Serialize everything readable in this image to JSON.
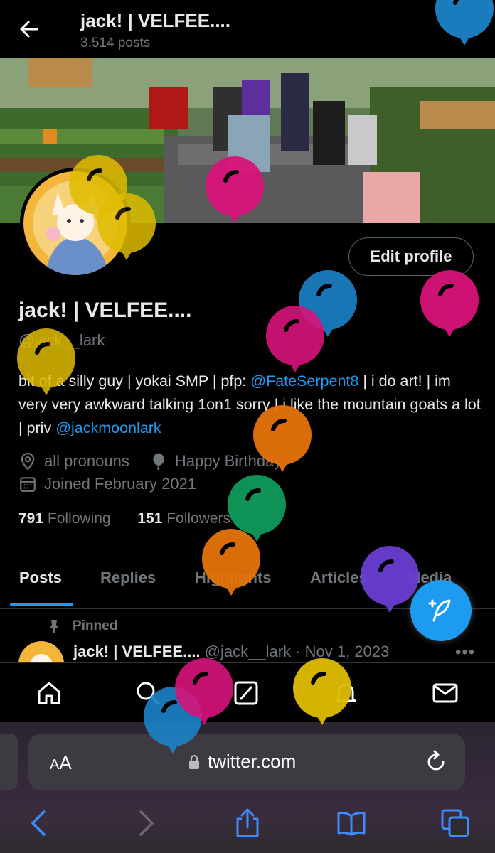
{
  "header": {
    "title": "jack! | VELFEE....",
    "post_count": "3,514 posts"
  },
  "profile": {
    "edit_button": "Edit profile",
    "display_name": "jack! | VELFEE....",
    "handle": "@jack__lark",
    "bio": {
      "part1": "bit of a silly guy | yokai SMP | pfp: ",
      "mention1": "@FateSerpent8",
      "part2": " | i do art! | im very very awkward talking 1on1 sorry | i like the mountain goats a lot | priv ",
      "mention2": "@jackmoonlark"
    },
    "pronouns": "all pronouns",
    "birthday": "Happy Birthday!",
    "joined": "Joined February 2021",
    "following_count": "791",
    "following_label": "Following",
    "followers_count": "151",
    "followers_label": "Followers"
  },
  "tabs": [
    "Posts",
    "Replies",
    "Highlights",
    "Articles",
    "Media"
  ],
  "active_tab": "Posts",
  "pinned": {
    "label": "Pinned",
    "name": "jack! | VELFEE....",
    "meta": "@jack__lark · Nov 1, 2023",
    "more": "•••"
  },
  "bottom_nav": [
    "home-icon",
    "search-icon",
    "grok-icon",
    "notifications-icon",
    "messages-icon"
  ],
  "browser": {
    "aa_label_small": "A",
    "aa_label_large": "A",
    "url": "twitter.com"
  },
  "colors": {
    "accent": "#1d9bf0",
    "balloon_pink": "#d8137a",
    "balloon_blue": "#1c83c8",
    "balloon_yellow": "#e0bc00",
    "balloon_orange": "#e4730a",
    "balloon_green": "#0f9a5b",
    "balloon_purple": "#6a3fd2"
  }
}
